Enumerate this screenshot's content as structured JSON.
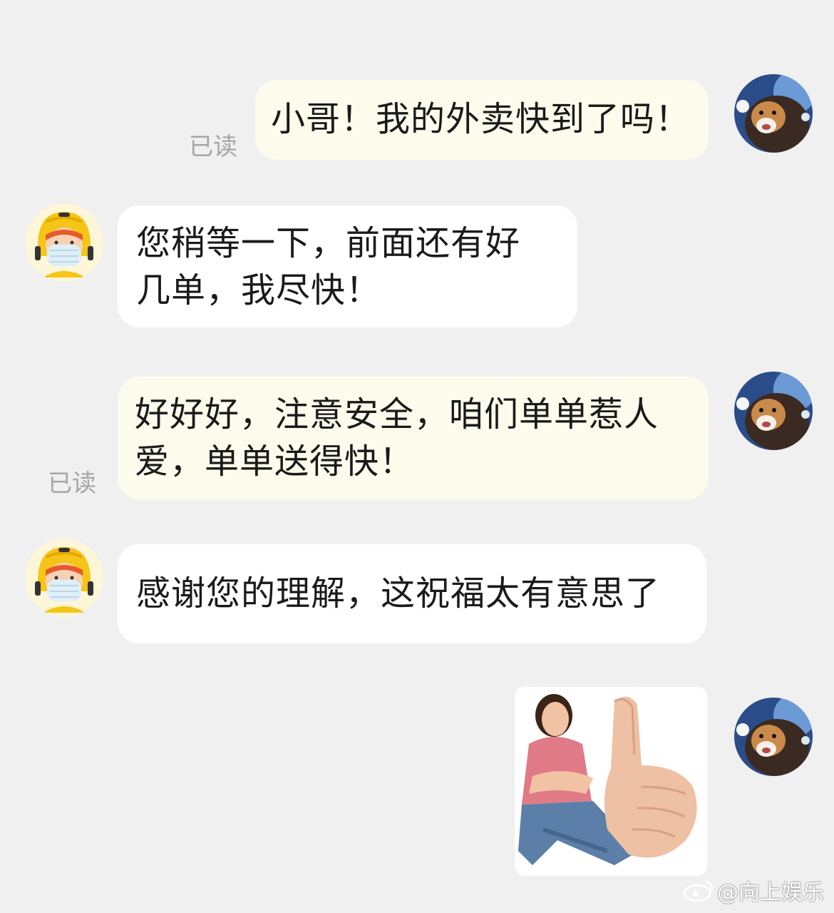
{
  "messages": [
    {
      "side": "mine",
      "text": "小哥！我的外卖快到了吗！",
      "read": "已读"
    },
    {
      "side": "theirs",
      "line1": "您稍等一下，前面还有好",
      "line2": "几单，我尽快！"
    },
    {
      "side": "mine",
      "line1": "好好好，注意安全，咱们单单惹人",
      "line2": "爱，单单送得快！",
      "read": "已读"
    },
    {
      "side": "theirs",
      "text": "感谢您的理解，这祝福太有意思了"
    },
    {
      "side": "mine",
      "type": "sticker",
      "description": "thumbs-up-sticker"
    }
  ],
  "watermark": "@向上娱乐",
  "colors": {
    "background": "#f0f0f0",
    "mine_bubble": "#fdfbec",
    "theirs_bubble": "#ffffff",
    "read_text": "#a6a6a6",
    "courier_helmet": "#f5c518"
  },
  "icons": {
    "user_avatar": "cat-avatar-icon",
    "courier_avatar": "delivery-rider-avatar-icon",
    "watermark_logo": "weibo-icon"
  }
}
